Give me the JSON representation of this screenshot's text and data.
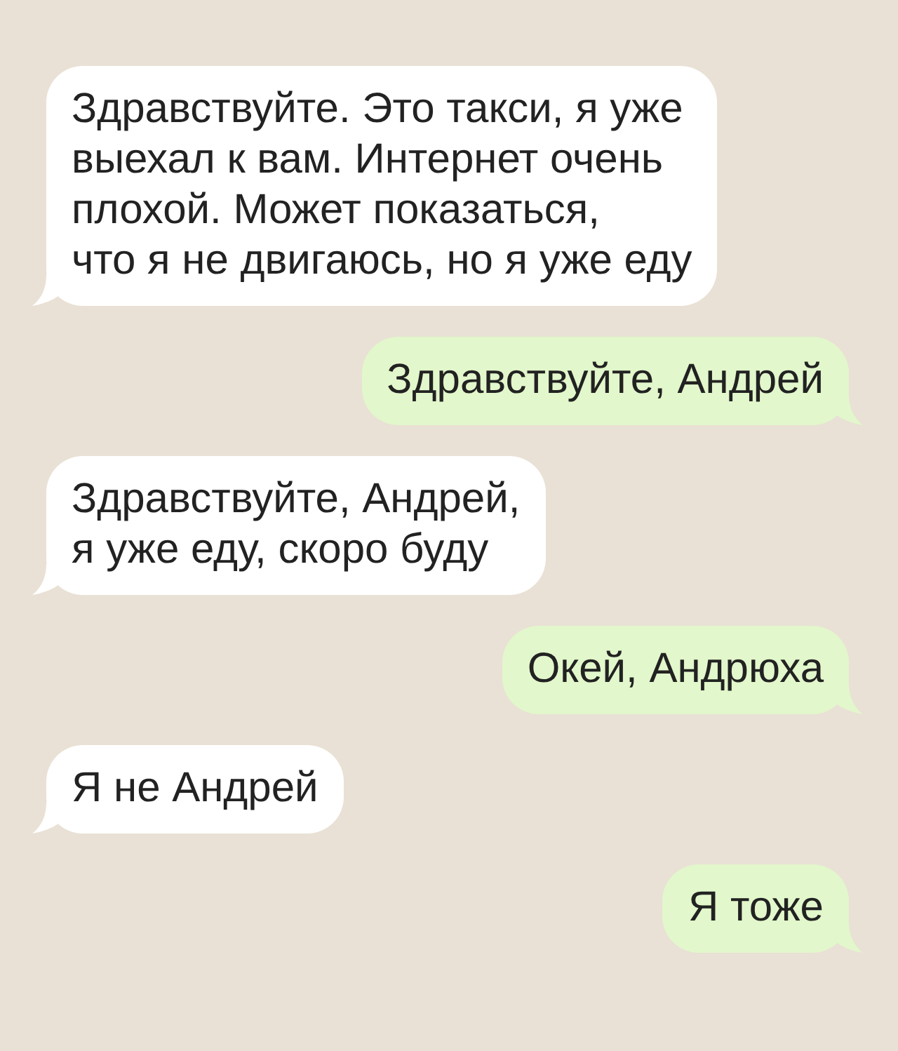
{
  "messages": [
    {
      "kind": "incoming",
      "text": "Здравствуйте. Это такси, я уже\nвыехал к вам. Интернет очень\nплохой. Может показаться,\nчто я не двигаюсь, но я уже еду"
    },
    {
      "kind": "outgoing",
      "text": "Здравствуйте, Андрей"
    },
    {
      "kind": "incoming",
      "text": "Здравствуйте, Андрей,\nя уже еду, скоро буду"
    },
    {
      "kind": "outgoing",
      "text": "Окей, Андрюха"
    },
    {
      "kind": "incoming",
      "text": "Я не Андрей"
    },
    {
      "kind": "outgoing",
      "text": "Я тоже"
    }
  ]
}
